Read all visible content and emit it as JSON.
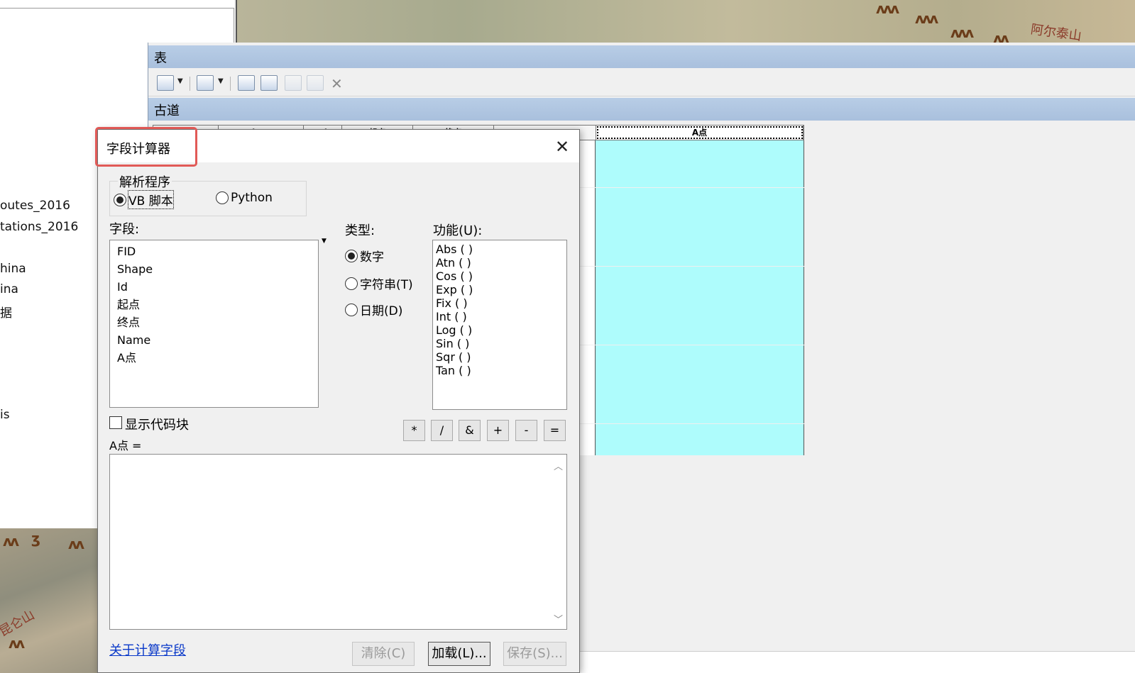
{
  "map": {
    "top_label": "阿尔泰山",
    "bottom_label": "昆仑山"
  },
  "toc": {
    "items": [
      "outes_2016",
      "tations_2016",
      "hina",
      "ina",
      "据",
      "is"
    ]
  },
  "table_window": {
    "title": "表",
    "table_name": "古道",
    "columns": [
      "ID",
      "Shape",
      "Id",
      "起点",
      "终点",
      "Name",
      "A点"
    ],
    "selected_column": "A点",
    "row_count": 20,
    "colors": {
      "selected_column_fill": "#aefcfc",
      "title_bar": "#b8cde6"
    }
  },
  "dialog": {
    "title": "字段计算器",
    "parser_group_label": "解析程序",
    "parser_options": [
      "VB 脚本",
      "Python"
    ],
    "parser_selected": "VB 脚本",
    "fields_label": "字段:",
    "fields": [
      "FID",
      "Shape",
      "Id",
      "起点",
      "终点",
      "Name",
      "A点"
    ],
    "type_label": "类型:",
    "type_options": [
      "数字",
      "字符串(T)",
      "日期(D)"
    ],
    "type_selected": "数字",
    "functions_label": "功能(U):",
    "functions": [
      "Abs ( )",
      "Atn ( )",
      "Cos ( )",
      "Exp ( )",
      "Fix ( )",
      "Int ( )",
      "Log ( )",
      "Sin ( )",
      "Sqr ( )",
      "Tan ( )"
    ],
    "show_codeblock_label": "显示代码块",
    "show_codeblock_checked": false,
    "operators": [
      "*",
      "/",
      "&",
      "+",
      "-",
      "="
    ],
    "expression_label": "A点 =",
    "expression_value": "",
    "help_link": "关于计算字段",
    "buttons": {
      "clear": "清除(C)",
      "load": "加载(L)...",
      "save": "保存(S)..."
    },
    "highlight_color": "#e15a57"
  }
}
